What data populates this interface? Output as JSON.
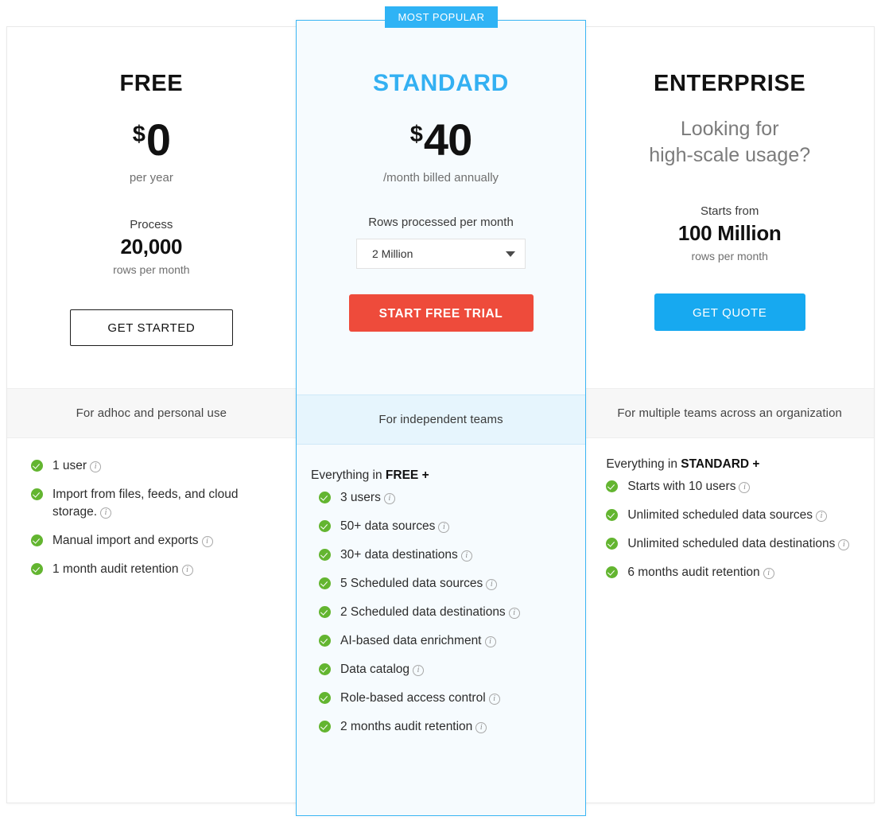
{
  "badge": {
    "label": "MOST POPULAR"
  },
  "plans": [
    {
      "id": "free",
      "name": "FREE",
      "currency": "$",
      "amount": "0",
      "price_note": "per year",
      "usage_label": "Process",
      "usage_value": "20,000",
      "usage_unit": "rows per month",
      "cta": "GET STARTED",
      "cta_style": "outline",
      "band": "For adhoc and personal use",
      "everything_prefix": "",
      "everything_plan": "",
      "everything_suffix": "",
      "features": [
        "1 user",
        "Import from files, feeds, and cloud storage.",
        "Manual import and exports",
        "1 month audit retention"
      ]
    },
    {
      "id": "standard",
      "name": "STANDARD",
      "currency": "$",
      "amount": "40",
      "price_note": "/month billed annually",
      "select_label": "Rows processed per month",
      "select_value": "2 Million",
      "select_options": [
        "2 Million"
      ],
      "cta": "START FREE TRIAL",
      "cta_style": "red",
      "band": "For independent teams",
      "everything_prefix": "Everything in ",
      "everything_plan": "FREE",
      "everything_suffix": " +",
      "features": [
        "3 users",
        "50+ data sources",
        "30+ data destinations",
        "5 Scheduled data sources",
        "2 Scheduled data destinations",
        "AI-based data enrichment",
        "Data catalog",
        "Role-based access control",
        "2 months audit retention"
      ]
    },
    {
      "id": "enterprise",
      "name": "ENTERPRISE",
      "tagline_line1": "Looking for",
      "tagline_line2": "high-scale usage?",
      "usage_label": "Starts from",
      "usage_value": "100 Million",
      "usage_unit": "rows per month",
      "cta": "GET QUOTE",
      "cta_style": "blue",
      "band": "For multiple teams across an organization",
      "everything_prefix": "Everything in ",
      "everything_plan": "STANDARD",
      "everything_suffix": " +",
      "features": [
        "Starts with 10 users",
        "Unlimited scheduled data sources",
        "Unlimited scheduled data destinations",
        "6 months audit retention"
      ]
    }
  ],
  "icons": {
    "check": "check-circle-icon",
    "info": "info-icon",
    "caret": "chevron-down-icon"
  },
  "colors": {
    "accent_blue": "#33b0f2",
    "badge_blue": "#2fb3f5",
    "cta_red": "#ee4b3b",
    "cta_blue": "#17a9f0",
    "check_green": "#63b530",
    "card_bg": "#f6fbfe",
    "band_gray": "#f7f7f7"
  }
}
